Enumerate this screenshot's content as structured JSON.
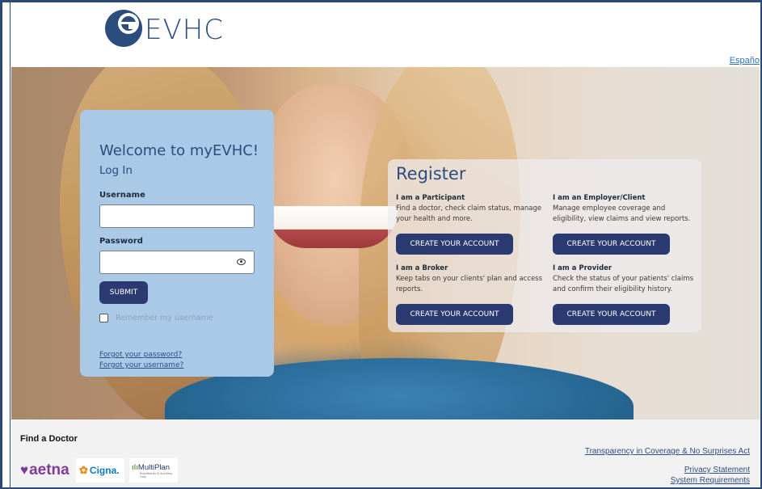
{
  "header": {
    "logo_letter": "e",
    "logo_text": "EVHC",
    "language_link": "Españo"
  },
  "login": {
    "welcome": "Welcome to myEVHC!",
    "heading": "Log In",
    "username_label": "Username",
    "username_value": "",
    "password_label": "Password",
    "password_value": "",
    "submit_label": "SUBMIT",
    "remember_label": "Remember my username",
    "remember_checked": false,
    "forgot_password": "Forgot your password?",
    "forgot_username": "Forgot your username?"
  },
  "register": {
    "title": "Register",
    "options": [
      {
        "title": "I am a Participant",
        "description": "Find a doctor, check claim status, manage your health and more.",
        "button": "CREATE YOUR ACCOUNT"
      },
      {
        "title": "I am an Employer/Client",
        "description": "Manage employee coverage and eligibility, view claims and view reports.",
        "button": "CREATE YOUR ACCOUNT"
      },
      {
        "title": "I am a Broker",
        "description": "Keep tabs on your clients' plan and access reports.",
        "button": "CREATE YOUR ACCOUNT"
      },
      {
        "title": "I am a Provider",
        "description": "Check the status of your patients' claims and confirm their eligibility history.",
        "button": "CREATE YOUR ACCOUNT"
      }
    ]
  },
  "footer": {
    "find_doctor": "Find a Doctor",
    "partners": {
      "aetna": "aetna",
      "cigna": "Cigna.",
      "multiplan": "MultiPlan",
      "multiplan_sub": "Practitioner & Ancillary Only"
    },
    "links": {
      "transparency": "Transparency in Coverage & No Surprises Act",
      "privacy": "Privacy Statement",
      "system": "System Requirements"
    }
  },
  "colors": {
    "brand_navy": "#2b3a70",
    "brand_blue": "#2b4d7e",
    "login_panel": "#a9c9e6"
  }
}
